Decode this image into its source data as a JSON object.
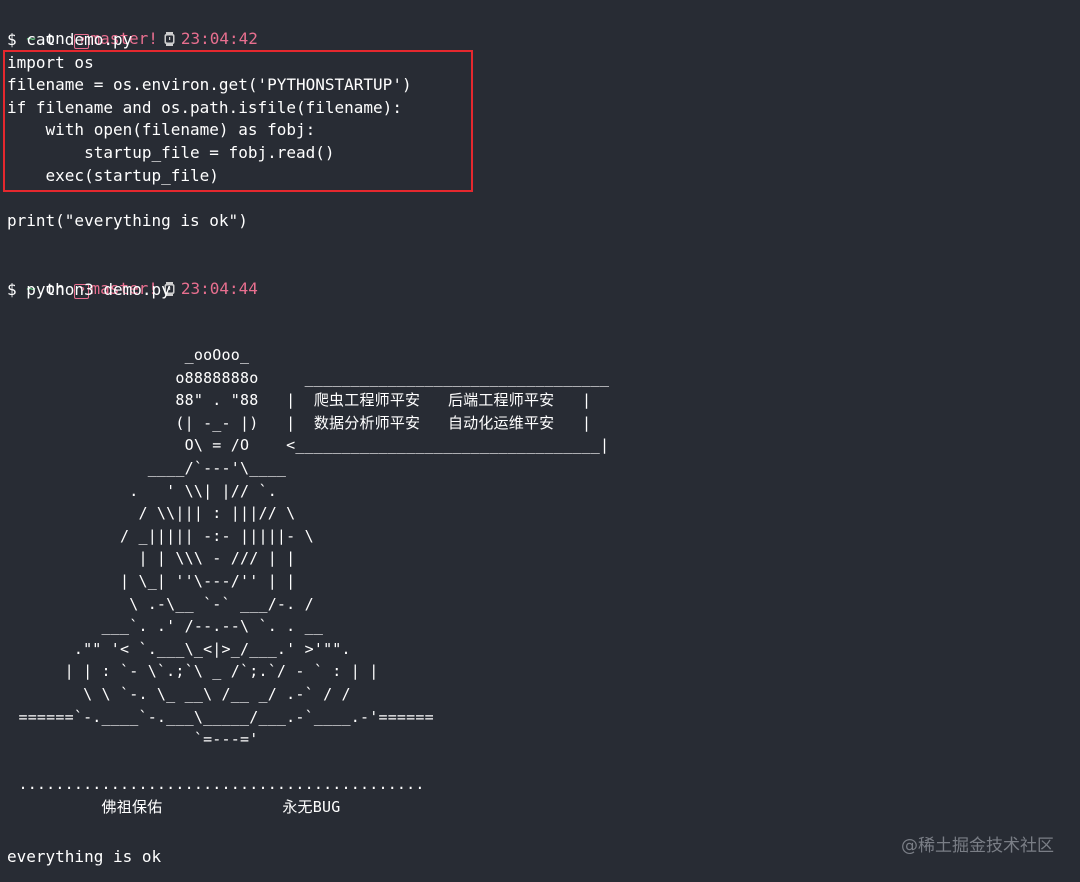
{
  "prompt1": {
    "tilde": "~",
    "on": " on ",
    "branch_icon": "?",
    "branch": "master!",
    "time": "23:04:42"
  },
  "cmd1": "$ cat demo.py",
  "code": [
    "import os",
    "filename = os.environ.get('PYTHONSTARTUP')",
    "if filename and os.path.isfile(filename):",
    "    with open(filename) as fobj:",
    "        startup_file = fobj.read()",
    "    exec(startup_file)"
  ],
  "print_line": "print(\"everything is ok\")",
  "prompt2": {
    "tilde": "~",
    "on": " on ",
    "branch_icon": "?",
    "branch": "master!",
    "time": "23:04:44"
  },
  "cmd2": "$ python3 demo.py",
  "ascii_art": "                    _ooOoo_\n                   o8888888o     _________________________________\n                   88\" . \"88   |  爬虫工程师平安   后端工程师平安   |\n                   (| -_- |)   |  数据分析师平安   自动化运维平安   |\n                    O\\ = /O    <_________________________________|\n                ____/`---'\\____\n              .   ' \\\\| |// `.\n               / \\\\||| : |||// \\\n             / _||||| -:- |||||- \\\n               | | \\\\\\ - /// | |\n             | \\_| ''\\---/'' | |\n              \\ .-\\__ `-` ___/-. /\n           ___`. .' /--.--\\ `. . __\n        .\"\" '< `.___\\_<|>_/___.' >'\"\".\n       | | : `- \\`.;`\\ _ /`;.`/ - ` : | |\n         \\ \\ `-. \\_ __\\ /__ _/ .-` / /\n  ======`-.____`-.___\\_____/___.-`____.-'======\n                     `=---='\n\n  ............................................\n           佛祖保佑             永无BUG",
  "output": "everything is ok",
  "watermark": "@稀土掘金技术社区"
}
